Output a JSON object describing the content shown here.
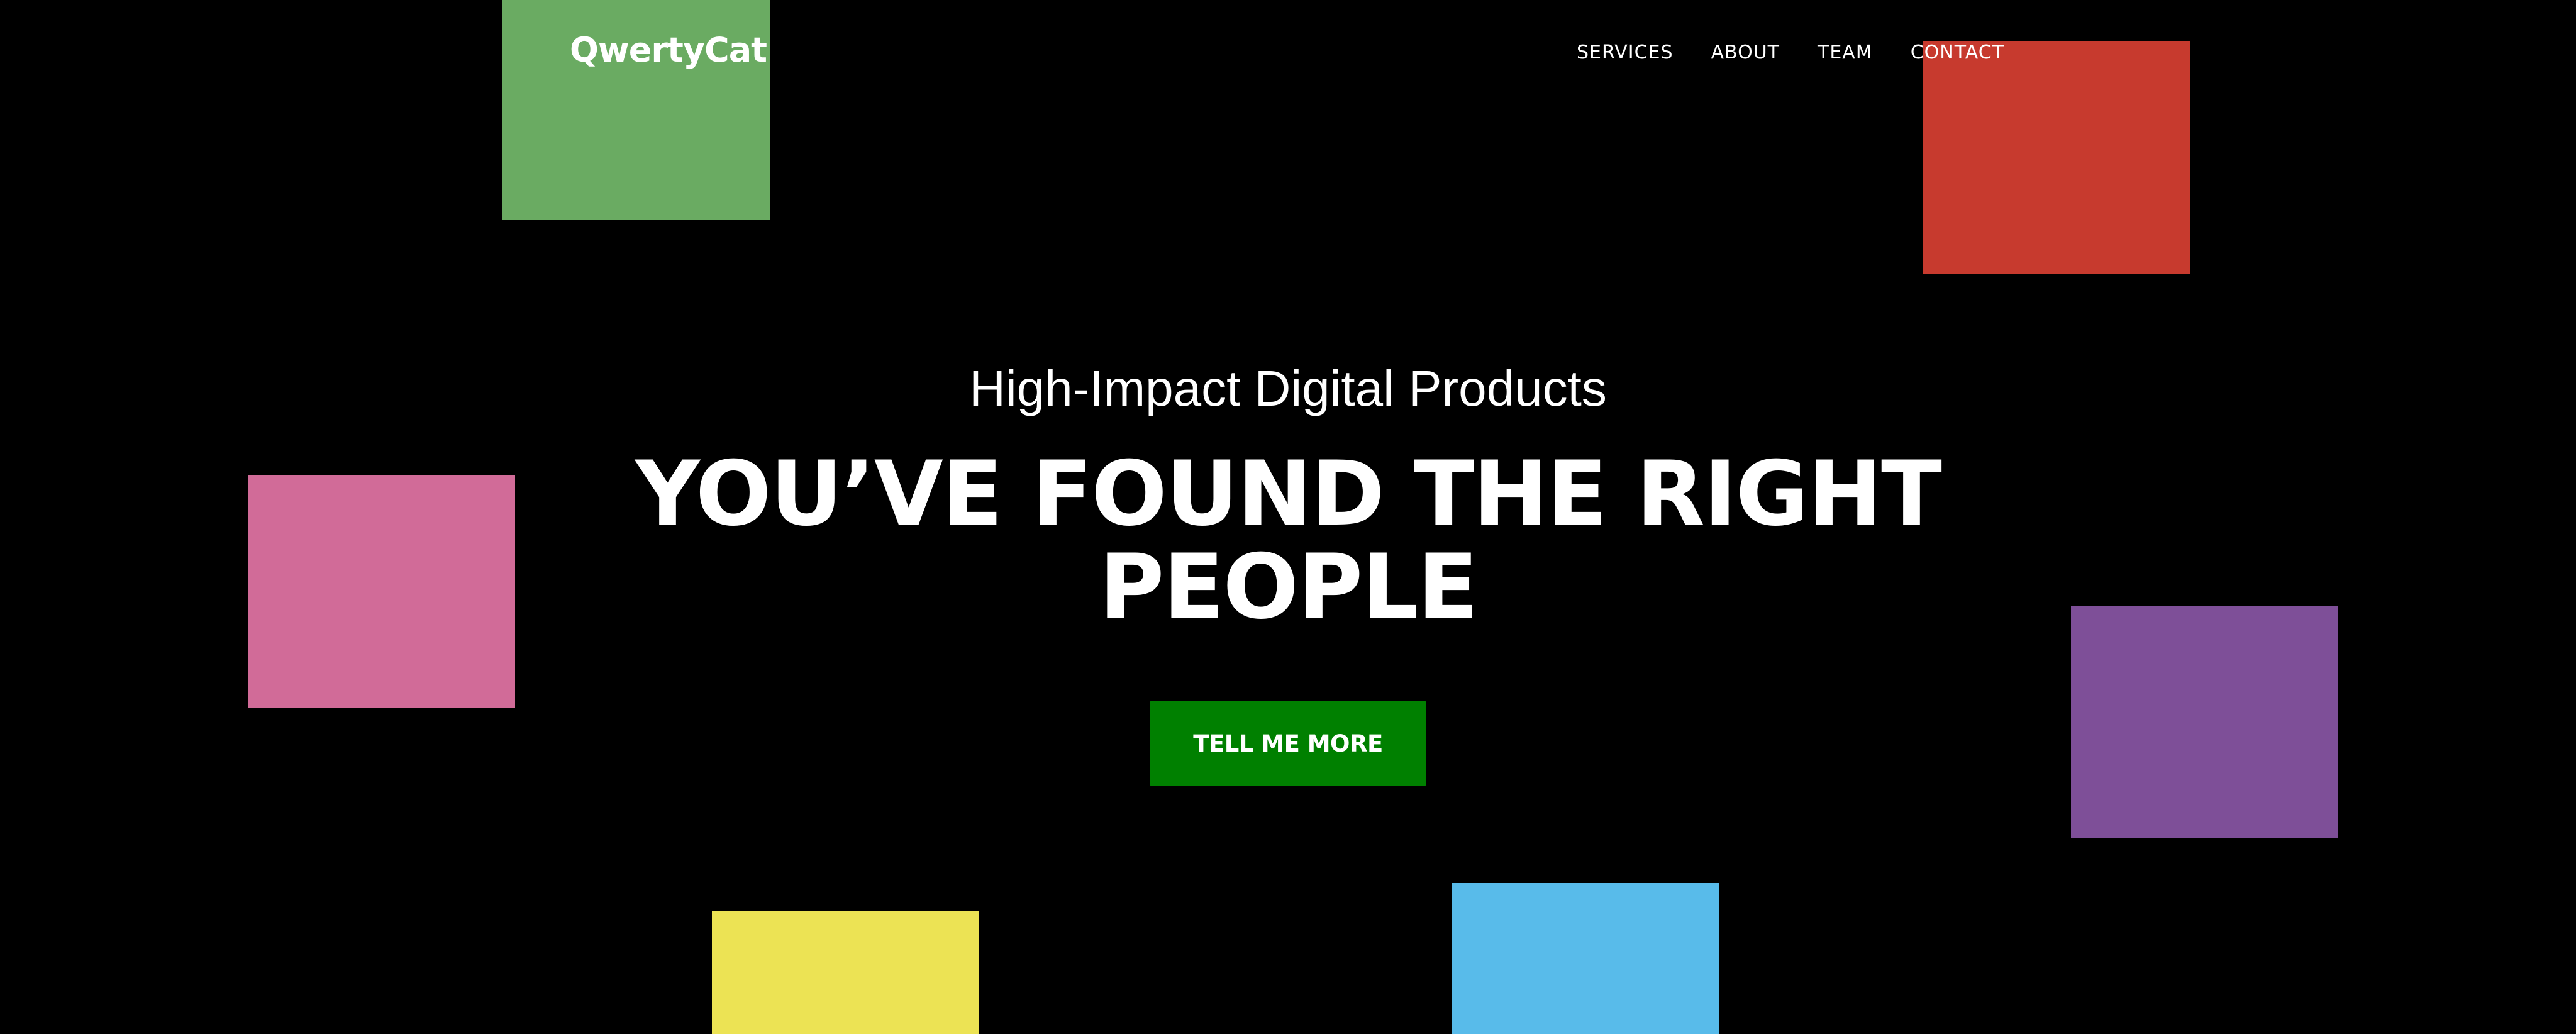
{
  "header": {
    "brand": "QwertyCat",
    "nav": [
      "SERVICES",
      "ABOUT",
      "TEAM",
      "CONTACT"
    ]
  },
  "hero": {
    "subheading": "High-Impact Digital Products",
    "heading": "YOU’VE FOUND THE RIGHT PEOPLE",
    "cta_label": "TELL ME MORE"
  },
  "colors": {
    "background": "#000000",
    "cta": "#008000",
    "block_green": "#6aab62",
    "block_red": "#c73a2e",
    "block_pink": "#d16b98",
    "block_purple": "#7e4f98",
    "block_yellow": "#ece354",
    "block_blue": "#58bbea"
  }
}
